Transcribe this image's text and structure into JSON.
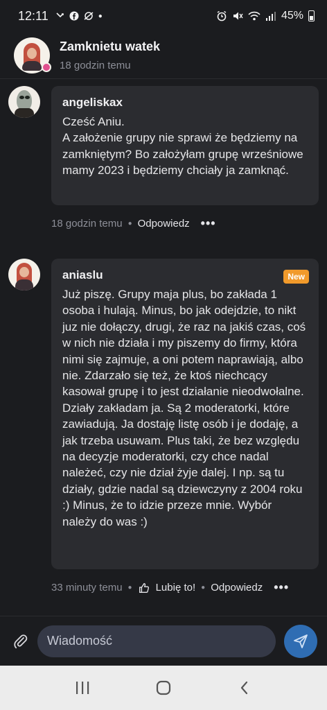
{
  "status_bar": {
    "time": "12:11",
    "battery": "45%"
  },
  "header": {
    "title": "Zamknietu watek",
    "subtitle": "18 godzin temu"
  },
  "messages": [
    {
      "author": "angeliskax",
      "text": "Cześć Aniu.\nA założenie grupy nie sprawi że będziemy na zamkniętym? Bo założyłam grupę wrześniowe mamy 2023 i będziemy chciały ja zamknąć.",
      "time": "18 godzin temu",
      "reply": "Odpowiedz",
      "more": "•••"
    },
    {
      "author": "aniaslu",
      "badge": "New",
      "text": "Już piszę. Grupy maja plus, bo zakłada 1 osoba i hulają. Minus, bo jak odejdzie, to nikt juz nie dołączy, drugi, że raz na jakiś czas, coś w nich nie działa i my piszemy do firmy, która nimi się zajmuje, a oni potem naprawiają, albo nie. Zdarzało się też, że ktoś niechcący kasował grupę i to jest działanie nieodwołalne. Działy zakładam ja. Są 2 moderatorki, które zawiadują. Ja dostaję listę osób i je dodaję, a jak trzeba usuwam. Plus taki, że bez względu na decyzje moderatorki, czy chce nadal należeć, czy nie dział żyje dalej. I np. są tu działy, gdzie nadal są dziewczyny z 2004 roku :) Minus, że to idzie przeze mnie. Wybór należy do was :)",
      "time": "33 minuty temu",
      "like": "Lubię to!",
      "reply": "Odpowiedz",
      "more": "•••"
    }
  ],
  "composer": {
    "placeholder": "Wiadomość"
  },
  "colors": {
    "accent": "#2f6db3",
    "badge": "#f19a2b",
    "bubble": "#2b2c30",
    "background": "#1b1c1f"
  }
}
